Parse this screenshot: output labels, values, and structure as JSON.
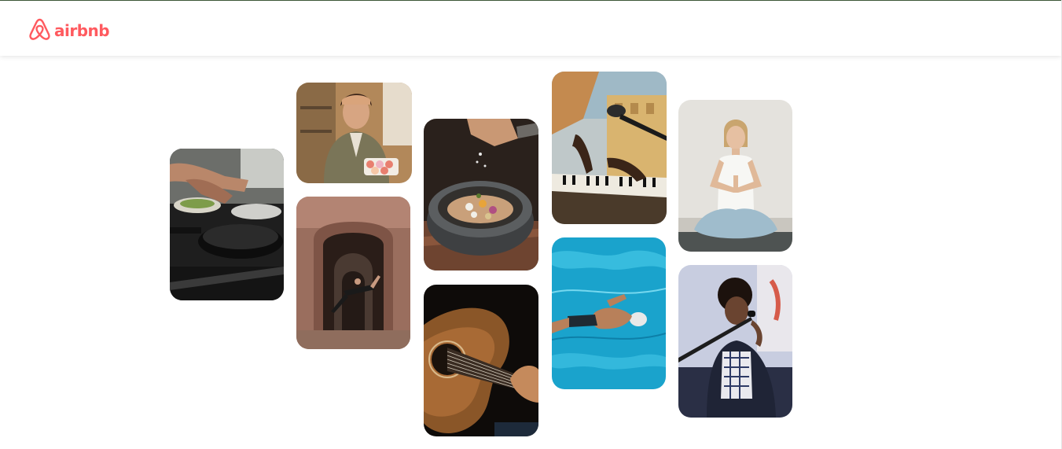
{
  "brand": {
    "name": "airbnb",
    "color": "#ff5a5f"
  },
  "gallery": {
    "tiles": [
      {
        "subject": "cooking-pans",
        "col": 1,
        "row": 1
      },
      {
        "subject": "woman-with-macarons",
        "col": 2,
        "row": 1
      },
      {
        "subject": "dancer-in-archway",
        "col": 2,
        "row": 2
      },
      {
        "subject": "seasoning-stone-bowl",
        "col": 3,
        "row": 1
      },
      {
        "subject": "acoustic-guitar",
        "col": 3,
        "row": 2
      },
      {
        "subject": "keyboard-and-microphone",
        "col": 4,
        "row": 1
      },
      {
        "subject": "swimmer-in-pool",
        "col": 4,
        "row": 2
      },
      {
        "subject": "meditating-woman",
        "col": 5,
        "row": 1
      },
      {
        "subject": "singer-at-microphone",
        "col": 5,
        "row": 2
      }
    ]
  }
}
